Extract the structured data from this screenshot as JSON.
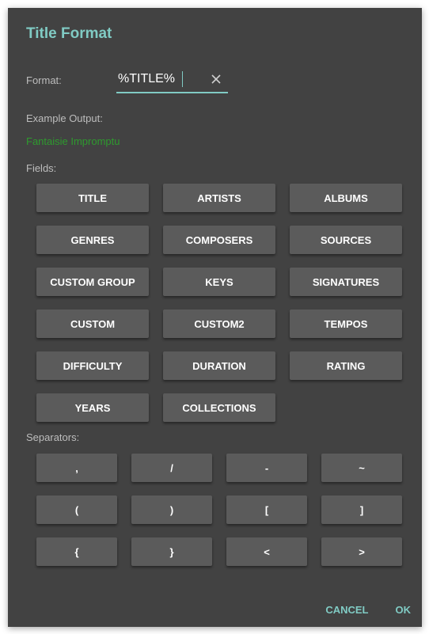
{
  "dialog": {
    "title": "Title Format",
    "format_label": "Format:",
    "format_value": "%TITLE%",
    "example_label": "Example Output:",
    "example_value": "Fantaisie Impromptu",
    "fields_label": "Fields:",
    "separators_label": "Separators:"
  },
  "fields": [
    "TITLE",
    "ARTISTS",
    "ALBUMS",
    "GENRES",
    "COMPOSERS",
    "SOURCES",
    "CUSTOM GROUP",
    "KEYS",
    "SIGNATURES",
    "CUSTOM",
    "CUSTOM2",
    "TEMPOS",
    "DIFFICULTY",
    "DURATION",
    "RATING",
    "YEARS",
    "COLLECTIONS"
  ],
  "separators": [
    ",",
    "/",
    "-",
    "~",
    "(",
    ")",
    "[",
    "]",
    "{",
    "}",
    "<",
    ">"
  ],
  "actions": {
    "cancel": "CANCEL",
    "ok": "OK"
  },
  "colors": {
    "dialog_bg": "#424242",
    "accent": "#80cbc4",
    "example_text": "#2e9a2e",
    "button_bg": "#5b5b5b"
  }
}
